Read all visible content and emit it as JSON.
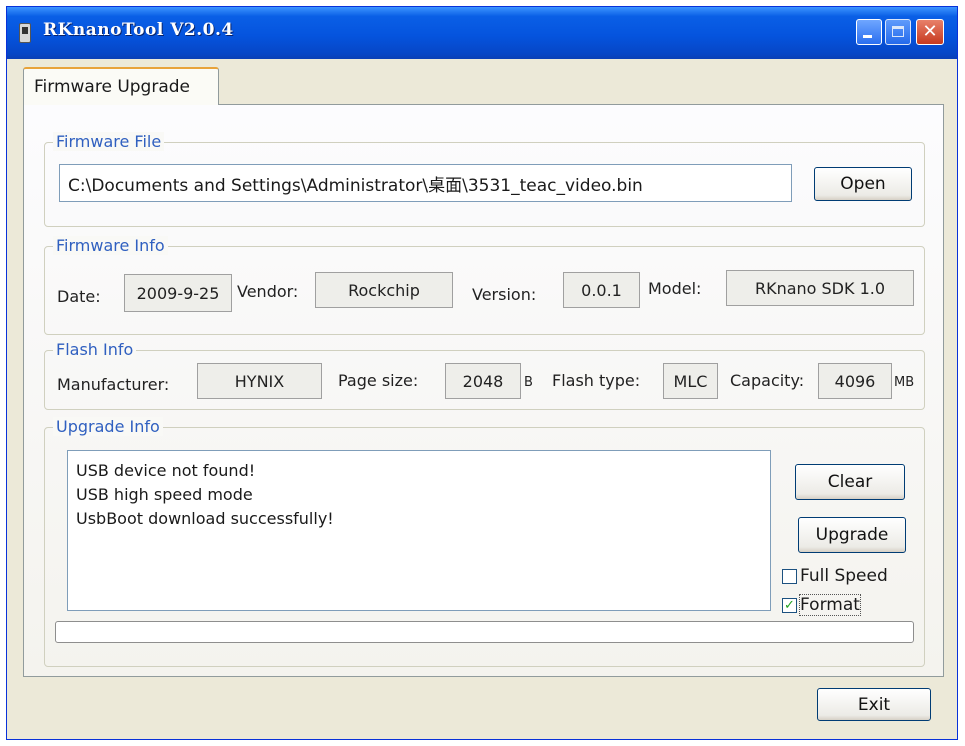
{
  "window": {
    "title": "RKnanoTool V2.0.4",
    "close_glyph": "✕"
  },
  "tabs": [
    {
      "label": "Firmware Upgrade",
      "active": true
    }
  ],
  "firmware_file": {
    "group_label": "Firmware File",
    "path": "C:\\Documents and Settings\\Administrator\\桌面\\3531_teac_video.bin",
    "open_label": "Open"
  },
  "firmware_info": {
    "group_label": "Firmware Info",
    "date_label": "Date:",
    "date": "2009-9-25",
    "vendor_label": "Vendor:",
    "vendor": "Rockchip",
    "version_label": "Version:",
    "version": "0.0.1",
    "model_label": "Model:",
    "model": "RKnano SDK 1.0"
  },
  "flash_info": {
    "group_label": "Flash Info",
    "manufacturer_label": "Manufacturer:",
    "manufacturer": "HYNIX",
    "page_size_label": "Page size:",
    "page_size": "2048",
    "page_size_unit": "B",
    "flash_type_label": "Flash type:",
    "flash_type": "MLC",
    "capacity_label": "Capacity:",
    "capacity": "4096",
    "capacity_unit": "MB"
  },
  "upgrade_info": {
    "group_label": "Upgrade Info",
    "log_lines": [
      "USB device not found!",
      "USB high speed mode",
      "UsbBoot download successfully!"
    ],
    "clear_label": "Clear",
    "upgrade_label": "Upgrade",
    "full_speed_label": "Full Speed",
    "full_speed_checked": false,
    "format_label": "Format",
    "format_checked": true,
    "check_mark": "✓",
    "progress": 0
  },
  "exit_label": "Exit"
}
